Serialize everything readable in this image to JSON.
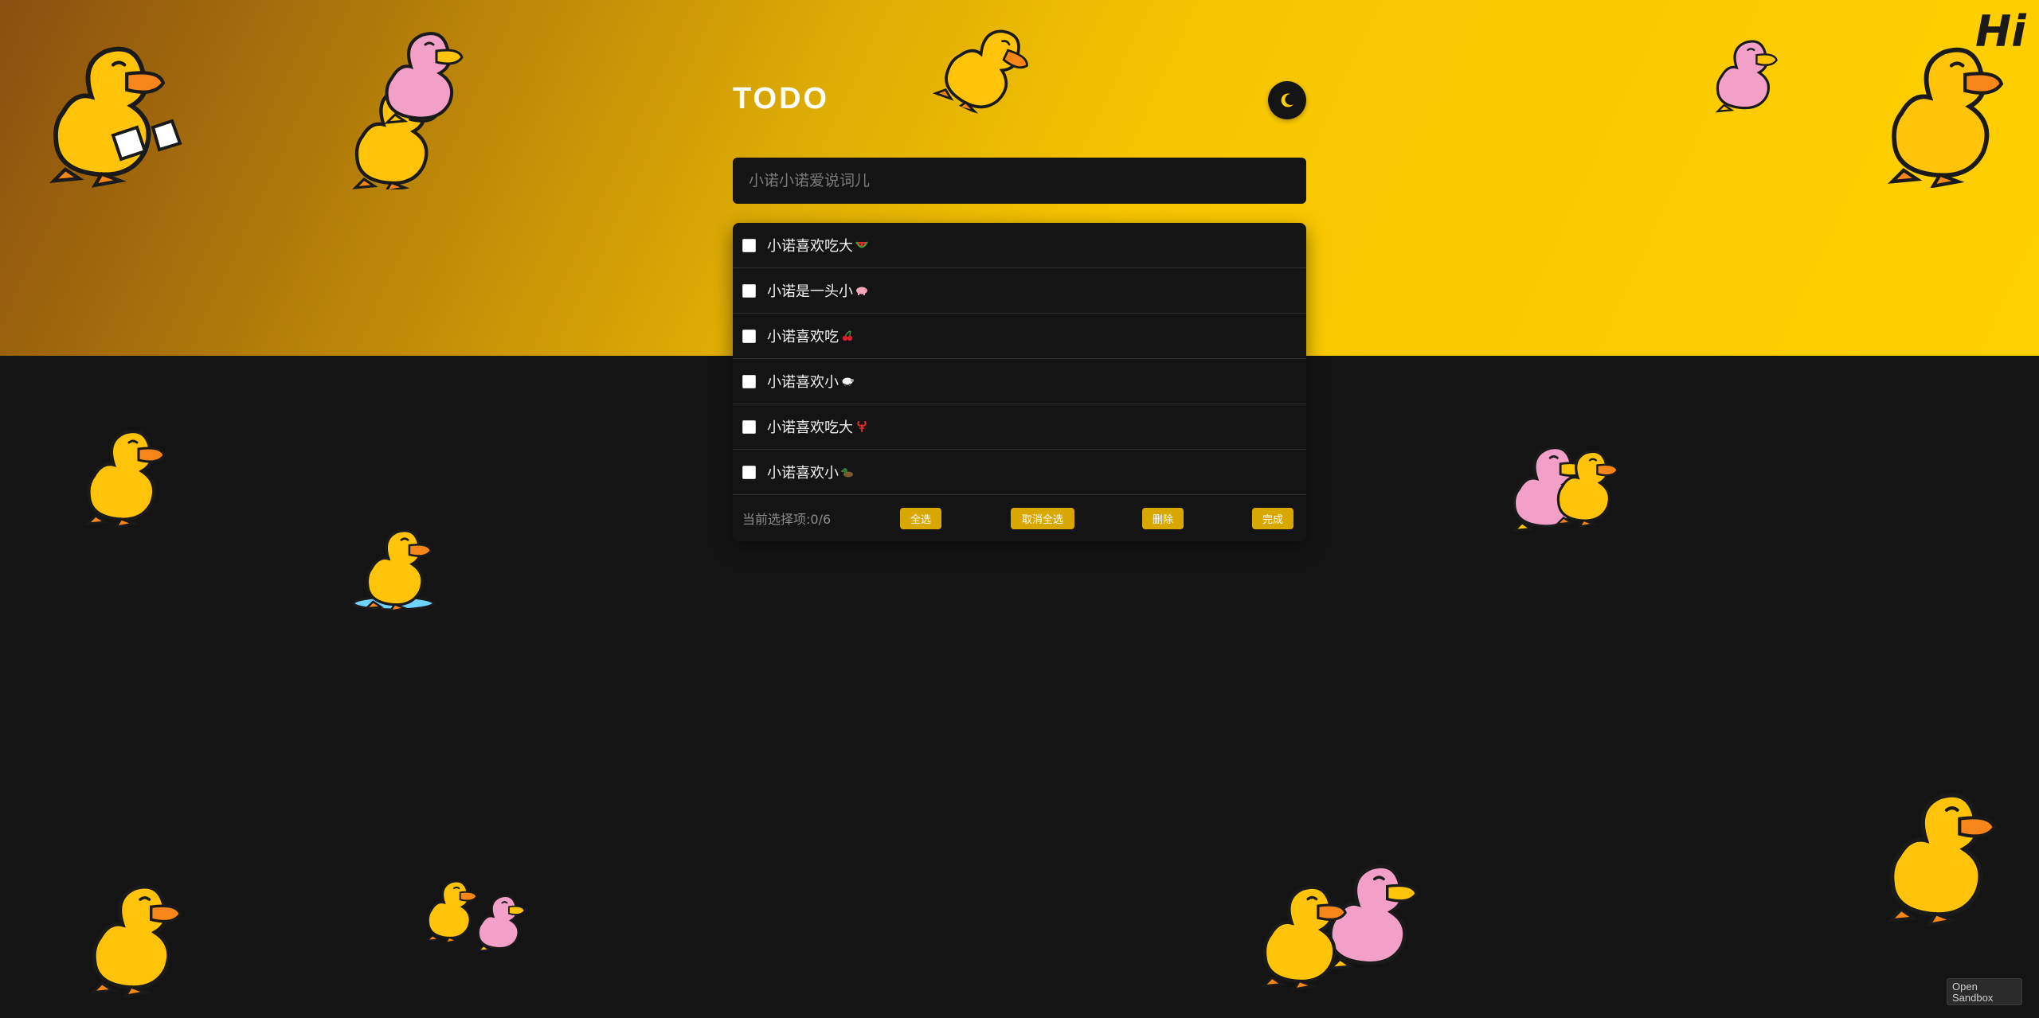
{
  "app": {
    "title": "TODO",
    "theme_toggle_icon": "moon-icon"
  },
  "input": {
    "placeholder": "小诺小诺爱说词儿",
    "value": ""
  },
  "todos": [
    {
      "text": "小诺喜欢吃大",
      "emoji": "watermelon-icon",
      "checked": false
    },
    {
      "text": "小诺是一头小",
      "emoji": "pig-icon",
      "checked": false
    },
    {
      "text": "小诺喜欢吃",
      "emoji": "cherries-icon",
      "checked": false
    },
    {
      "text": "小诺喜欢小",
      "emoji": "sheep-icon",
      "checked": false
    },
    {
      "text": "小诺喜欢吃大",
      "emoji": "lobster-icon",
      "checked": false
    },
    {
      "text": "小诺喜欢小",
      "emoji": "duck-icon",
      "checked": false
    }
  ],
  "footer": {
    "selected_label": "当前选择项:0/6",
    "select_all": "全选",
    "cancel_select_all": "取消全选",
    "delete": "删除",
    "done": "完成"
  },
  "sandbox": {
    "label": "Open Sandbox"
  },
  "decor": {
    "stickers": "b-duck-sticker",
    "hi_text": "Hi"
  },
  "colors": {
    "hero_gold": "#ffd000",
    "accent_button": "#d9a800",
    "background_dark": "#141414",
    "duck_yellow": "#ffc30a",
    "duck_pink": "#f3a0c8",
    "duck_orange": "#f7861a"
  }
}
